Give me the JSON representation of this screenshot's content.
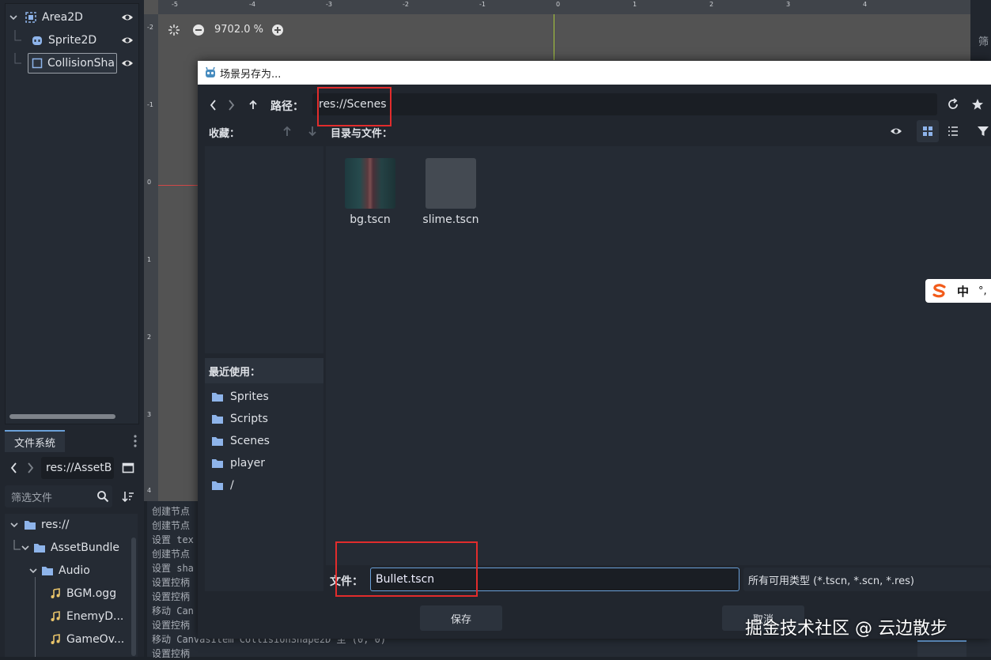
{
  "scene_tree": {
    "nodes": [
      {
        "name": "Area2D",
        "icon": "area2d-icon"
      },
      {
        "name": "Sprite2D",
        "icon": "sprite2d-icon"
      },
      {
        "name": "CollisionSha",
        "icon": "collision-shape-icon"
      }
    ]
  },
  "filesystem": {
    "tab_label": "文件系统",
    "path": "res://AssetB",
    "filter_placeholder": "筛选文件",
    "tree": [
      {
        "label": "res://",
        "type": "folder"
      },
      {
        "label": "AssetBundle",
        "type": "folder"
      },
      {
        "label": "Audio",
        "type": "folder"
      },
      {
        "label": "BGM.ogg",
        "type": "audio"
      },
      {
        "label": "EnemyD...",
        "type": "audio"
      },
      {
        "label": "GameOv...",
        "type": "audio"
      }
    ]
  },
  "viewport": {
    "zoom": "9702.0 %",
    "ruler_top_marks": [
      "-5",
      "-4",
      "-3",
      "-2",
      "-1",
      "0",
      "1",
      "2",
      "3",
      "4"
    ],
    "ruler_left_marks": [
      "-2",
      "-1",
      "0",
      "1",
      "2",
      "3",
      "4"
    ]
  },
  "right_strip": {
    "label": "筛"
  },
  "console": {
    "lines": [
      "创建节点",
      "创建节点",
      "设置 tex",
      "创建节点",
      "设置 sha",
      "设置控柄",
      "设置控柄",
      "移动 Can",
      "设置控柄",
      "移动 CanvasItem CollisionShape2D 至 (0, 0)",
      "设置控柄"
    ]
  },
  "dialog": {
    "title": "场景另存为...",
    "path_label": "路径：",
    "path_value": "res://Scenes",
    "favorites_label": "收藏：",
    "dirs_files_label": "目录与文件：",
    "recent_label": "最近使用：",
    "recent_items": [
      "Sprites",
      "Scripts",
      "Scenes",
      "player",
      "/"
    ],
    "files": [
      {
        "name": "bg.tscn",
        "thumb": "scene-thumbnail"
      },
      {
        "name": "slime.tscn",
        "thumb": "empty-thumbnail"
      }
    ],
    "file_label": "文件：",
    "file_value": "Bullet.tscn",
    "file_type": "所有可用类型 (*.tscn, *.scn, *.res)",
    "save_button": "保存",
    "cancel_button": "取消"
  },
  "ime": {
    "char": "中",
    "extra": "°,"
  },
  "watermark": "掘金技术社区 @ 云边散步",
  "colors": {
    "accent": "#6aa0d8",
    "highlight_box": "#e22c2c",
    "panel": "#252b34",
    "background": "#21262e"
  }
}
